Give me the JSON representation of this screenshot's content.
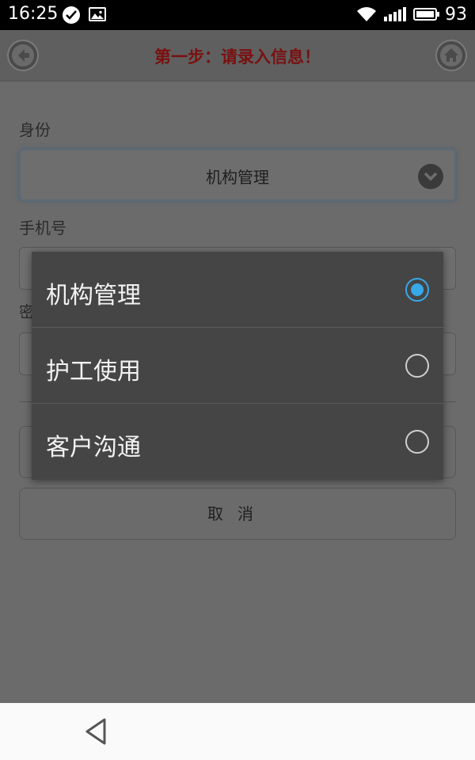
{
  "status_bar": {
    "time": "16:25",
    "battery_percent": "93",
    "icons": [
      "check-circle-icon",
      "image-icon",
      "wifi-icon",
      "signal-icon",
      "battery-icon"
    ]
  },
  "header": {
    "title": "第一步：请录入信息！",
    "back_icon": "back-arrow-icon",
    "home_icon": "home-icon"
  },
  "form": {
    "identity_label": "身份",
    "identity_value": "机构管理",
    "phone_label": "手机号",
    "password_label_partial": "密",
    "cancel_label": "取消"
  },
  "dialog": {
    "options": [
      {
        "label": "机构管理",
        "selected": true
      },
      {
        "label": "护工使用",
        "selected": false
      },
      {
        "label": "客户沟通",
        "selected": false
      }
    ]
  },
  "colors": {
    "title": "#7a1010",
    "radio_selected": "#38a8e8"
  }
}
